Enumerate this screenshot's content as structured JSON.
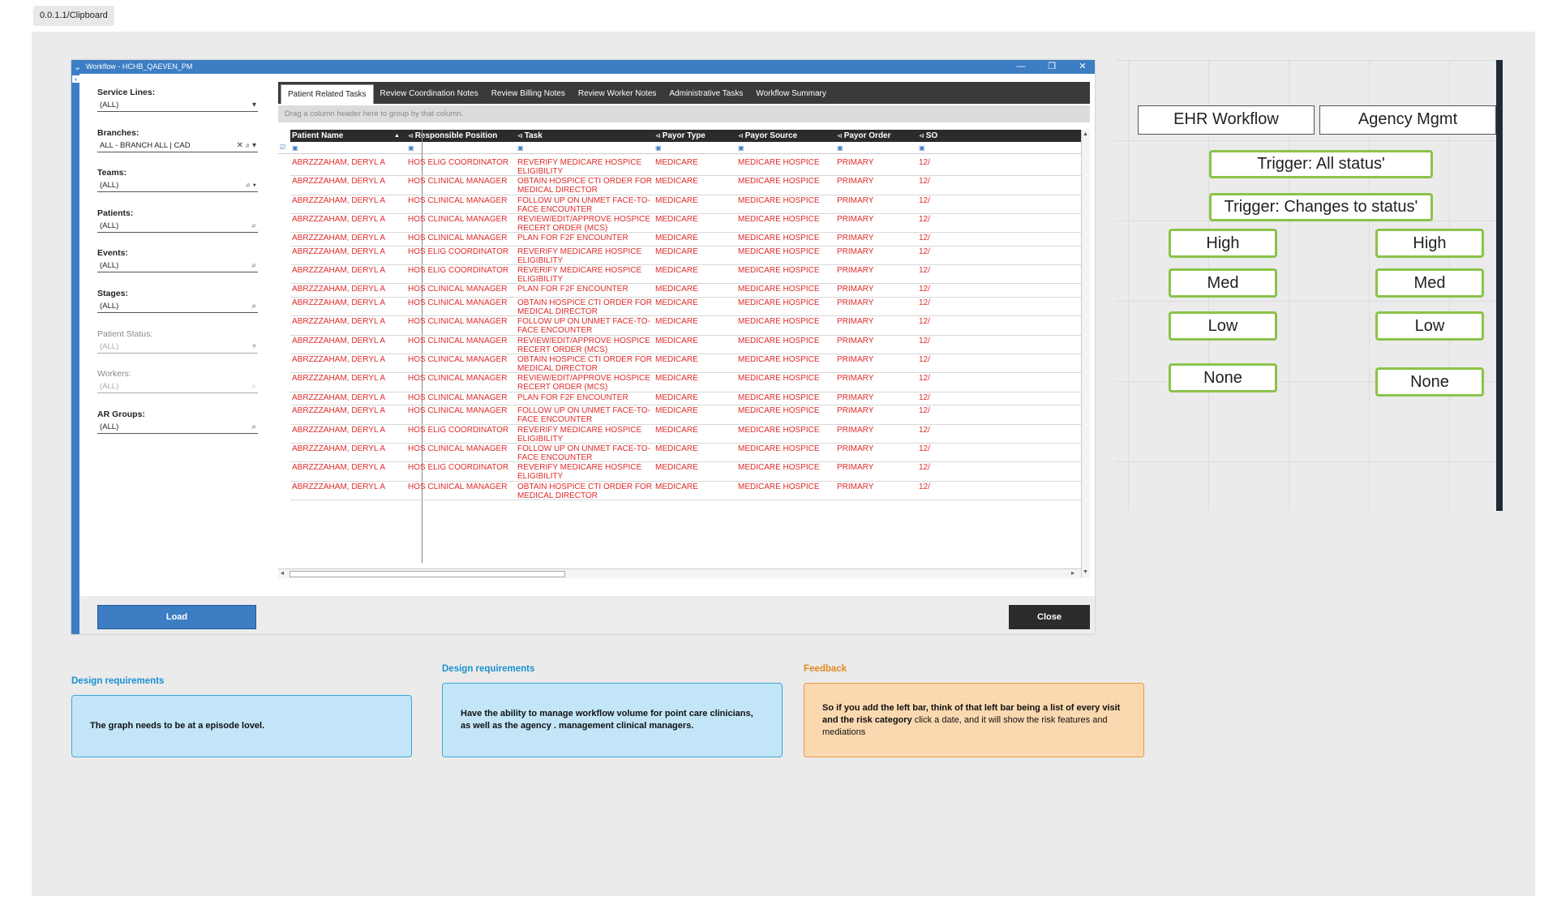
{
  "frame_label": "0.0.1.1/Clipboard",
  "window": {
    "title": "Workflow - HCHB_QAEVEN_PM",
    "minimize": "—",
    "restore": "❐",
    "close": "✕",
    "filters": [
      {
        "label": "Service Lines:",
        "value": "(ALL)",
        "tools": "▾",
        "disabled": false
      },
      {
        "label": "Branches:",
        "value": "ALL - BRANCH ALL | CAD",
        "tools": "✕ ⌕ ▾",
        "disabled": false
      },
      {
        "label": "Teams:",
        "value": "(ALL)",
        "tools": "⌕ ▾",
        "disabled": false
      },
      {
        "label": "Patients:",
        "value": "(ALL)",
        "tools": "⌕",
        "disabled": false
      },
      {
        "label": "Events:",
        "value": "(ALL)",
        "tools": "⌕",
        "disabled": false
      },
      {
        "label": "Stages:",
        "value": "(ALL)",
        "tools": "⌕",
        "disabled": false
      },
      {
        "label": "Patient Status:",
        "value": "(ALL)",
        "tools": "▾",
        "disabled": true
      },
      {
        "label": "Workers:",
        "value": "(ALL)",
        "tools": "⌕",
        "disabled": true
      },
      {
        "label": "AR Groups:",
        "value": "(ALL)",
        "tools": "⌕",
        "disabled": false
      }
    ],
    "load_label": "Load",
    "close_label": "Close",
    "tabs": [
      "Patient Related Tasks",
      "Review Coordination Notes",
      "Review Billing Notes",
      "Review Worker Notes",
      "Administrative Tasks",
      "Workflow Summary"
    ],
    "group_hint": "Drag a column header here to group by that column.",
    "columns": [
      "Patient Name",
      "Responsible Position",
      "Task",
      "Payor Type",
      "Payor Source",
      "Payor Order",
      "SO"
    ],
    "rows": [
      [
        "ABRZZZAHAM, DERYL A",
        "HOS ELIG COORDINATOR",
        "REVERIFY MEDICARE HOSPICE\nELIGIBILITY",
        "MEDICARE",
        "MEDICARE HOSPICE",
        "PRIMARY",
        "12/"
      ],
      [
        "ABRZZZAHAM, DERYL A",
        "HOS CLINICAL MANAGER",
        "OBTAIN HOSPICE CTI ORDER FOR\nMEDICAL DIRECTOR",
        "MEDICARE",
        "MEDICARE HOSPICE",
        "PRIMARY",
        "12/"
      ],
      [
        "ABRZZZAHAM, DERYL A",
        "HOS CLINICAL MANAGER",
        "FOLLOW UP ON UNMET FACE-TO-\nFACE ENCOUNTER",
        "MEDICARE",
        "MEDICARE HOSPICE",
        "PRIMARY",
        "12/"
      ],
      [
        "ABRZZZAHAM, DERYL A",
        "HOS CLINICAL MANAGER",
        "REVIEW/EDIT/APPROVE HOSPICE\nRECERT ORDER (MCS)",
        "MEDICARE",
        "MEDICARE HOSPICE",
        "PRIMARY",
        "12/"
      ],
      [
        "ABRZZZAHAM, DERYL A",
        "HOS CLINICAL MANAGER",
        "PLAN FOR F2F ENCOUNTER",
        "MEDICARE",
        "MEDICARE HOSPICE",
        "PRIMARY",
        "12/"
      ],
      [
        "ABRZZZAHAM, DERYL A",
        "HOS ELIG COORDINATOR",
        "REVERIFY MEDICARE HOSPICE\nELIGIBILITY",
        "MEDICARE",
        "MEDICARE HOSPICE",
        "PRIMARY",
        "12/"
      ],
      [
        "ABRZZZAHAM, DERYL A",
        "HOS ELIG COORDINATOR",
        "REVERIFY MEDICARE HOSPICE\nELIGIBILITY",
        "MEDICARE",
        "MEDICARE HOSPICE",
        "PRIMARY",
        "12/"
      ],
      [
        "ABRZZZAHAM, DERYL A",
        "HOS CLINICAL MANAGER",
        "PLAN FOR F2F ENCOUNTER",
        "MEDICARE",
        "MEDICARE HOSPICE",
        "PRIMARY",
        "12/"
      ],
      [
        "ABRZZZAHAM, DERYL A",
        "HOS CLINICAL MANAGER",
        "OBTAIN HOSPICE CTI ORDER FOR\nMEDICAL DIRECTOR",
        "MEDICARE",
        "MEDICARE HOSPICE",
        "PRIMARY",
        "12/"
      ],
      [
        "ABRZZZAHAM, DERYL A",
        "HOS CLINICAL MANAGER",
        "FOLLOW UP ON UNMET FACE-TO-\nFACE ENCOUNTER",
        "MEDICARE",
        "MEDICARE HOSPICE",
        "PRIMARY",
        "12/"
      ],
      [
        "ABRZZZAHAM, DERYL A",
        "HOS CLINICAL MANAGER",
        "REVIEW/EDIT/APPROVE HOSPICE\nRECERT ORDER (MCS)",
        "MEDICARE",
        "MEDICARE HOSPICE",
        "PRIMARY",
        "12/"
      ],
      [
        "ABRZZZAHAM, DERYL A",
        "HOS CLINICAL MANAGER",
        "OBTAIN HOSPICE CTI ORDER FOR\nMEDICAL DIRECTOR",
        "MEDICARE",
        "MEDICARE HOSPICE",
        "PRIMARY",
        "12/"
      ],
      [
        "ABRZZZAHAM, DERYL A",
        "HOS CLINICAL MANAGER",
        "REVIEW/EDIT/APPROVE HOSPICE\nRECERT ORDER (MCS)",
        "MEDICARE",
        "MEDICARE HOSPICE",
        "PRIMARY",
        "12/"
      ],
      [
        "ABRZZZAHAM, DERYL A",
        "HOS CLINICAL MANAGER",
        "PLAN FOR F2F ENCOUNTER",
        "MEDICARE",
        "MEDICARE HOSPICE",
        "PRIMARY",
        "12/"
      ],
      [
        "ABRZZZAHAM, DERYL A",
        "HOS CLINICAL MANAGER",
        "FOLLOW UP ON UNMET FACE-TO-\nFACE ENCOUNTER",
        "MEDICARE",
        "MEDICARE HOSPICE",
        "PRIMARY",
        "12/"
      ],
      [
        "ABRZZZAHAM, DERYL A",
        "HOS ELIG COORDINATOR",
        "REVERIFY MEDICARE HOSPICE\nELIGIBILITY",
        "MEDICARE",
        "MEDICARE HOSPICE",
        "PRIMARY",
        "12/"
      ],
      [
        "ABRZZZAHAM, DERYL A",
        "HOS CLINICAL MANAGER",
        "FOLLOW UP ON UNMET FACE-TO-\nFACE ENCOUNTER",
        "MEDICARE",
        "MEDICARE HOSPICE",
        "PRIMARY",
        "12/"
      ],
      [
        "ABRZZZAHAM, DERYL A",
        "HOS ELIG COORDINATOR",
        "REVERIFY MEDICARE HOSPICE\nELIGIBILITY",
        "MEDICARE",
        "MEDICARE HOSPICE",
        "PRIMARY",
        "12/"
      ],
      [
        "ABRZZZAHAM, DERYL A",
        "HOS CLINICAL MANAGER",
        "OBTAIN HOSPICE CTI ORDER FOR\nMEDICAL DIRECTOR",
        "MEDICARE",
        "MEDICARE HOSPICE",
        "PRIMARY",
        "12/"
      ]
    ]
  },
  "diagram": {
    "ehr_workflow": "EHR Workflow",
    "agency_mgmt": "Agency Mgmt",
    "trigger_all": "Trigger: All status'",
    "trigger_changes": "Trigger: Changes to status'",
    "left_levels": [
      "High",
      "Med",
      "Low",
      "None"
    ],
    "right_levels": [
      "High",
      "Med",
      "Low",
      "None"
    ]
  },
  "notes": [
    {
      "label": "Design requirements",
      "text_bold": "The graph needs to be at a episode lovel.",
      "text_plain": "",
      "color": "blue"
    },
    {
      "label": "Design requirements",
      "text_bold": "Have the ability to manage workflow volume for point care clinicians, as well as the agency . management clinical managers.",
      "text_plain": "",
      "color": "blue"
    },
    {
      "label": "Feedback",
      "text_bold": "So if you add the left bar, think of that left bar being a list of every visit and the risk category",
      "text_plain": " click a date, and it will show the risk features and mediations",
      "color": "orange"
    }
  ],
  "colors": {
    "accent": "#3c7dc4",
    "row_text": "#e02b2b",
    "note_label_blue": "#1a8fd1",
    "note_label_orange": "#e08a1e",
    "green_border": "#8bc34a"
  }
}
